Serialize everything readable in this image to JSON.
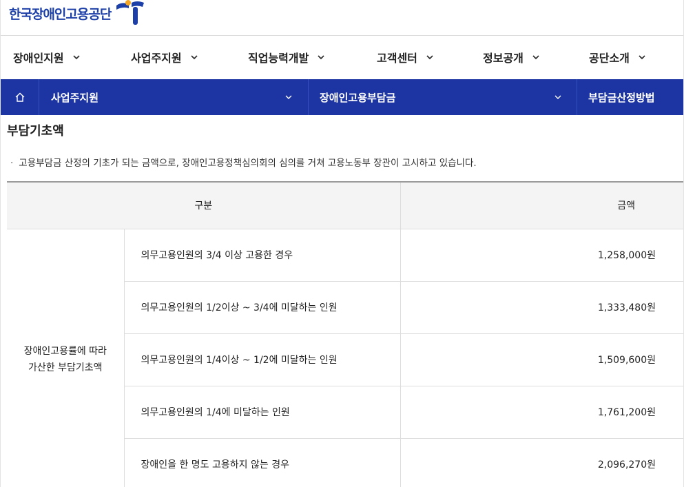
{
  "header": {
    "logo_text": "한국장애인고용공단",
    "brand_color": "#1c3fa8",
    "accent_color": "#f5a623"
  },
  "gnb": {
    "items": [
      {
        "label": "장애인지원"
      },
      {
        "label": "사업주지원"
      },
      {
        "label": "직업능력개발"
      },
      {
        "label": "고객센터"
      },
      {
        "label": "정보공개"
      },
      {
        "label": "공단소개"
      }
    ]
  },
  "breadcrumb": {
    "home_icon": "home-icon",
    "level1": "사업주지원",
    "level2": "장애인고용부담금",
    "level3": "부담금산정방법",
    "background": "#1d35a3"
  },
  "content": {
    "title": "부담기초액",
    "description": "고용부담금 산정의 기초가 되는 금액으로, 장애인고용정책심의회의 심의를 거쳐 고용노동부 장관이 고시하고 있습니다.",
    "bullet": "·"
  },
  "table": {
    "headers": {
      "category": "구분",
      "amount": "금액"
    },
    "group_label_line1": "장애인고용률에 따라",
    "group_label_line2": "가산한 부담기초액",
    "rows": [
      {
        "condition": "의무고용인원의 3/4 이상 고용한 경우",
        "amount": "1,258,000원"
      },
      {
        "condition": "의무고용인원의 1/2이상 ~ 3/4에 미달하는 인원",
        "amount": "1,333,480원"
      },
      {
        "condition": "의무고용인원의 1/4이상 ~ 1/2에 미달하는 인원",
        "amount": "1,509,600원"
      },
      {
        "condition": "의무고용인원의 1/4에 미달하는 인원",
        "amount": "1,761,200원"
      },
      {
        "condition": "장애인을 한 명도 고용하지 않는 경우",
        "amount": "2,096,270원"
      }
    ]
  }
}
